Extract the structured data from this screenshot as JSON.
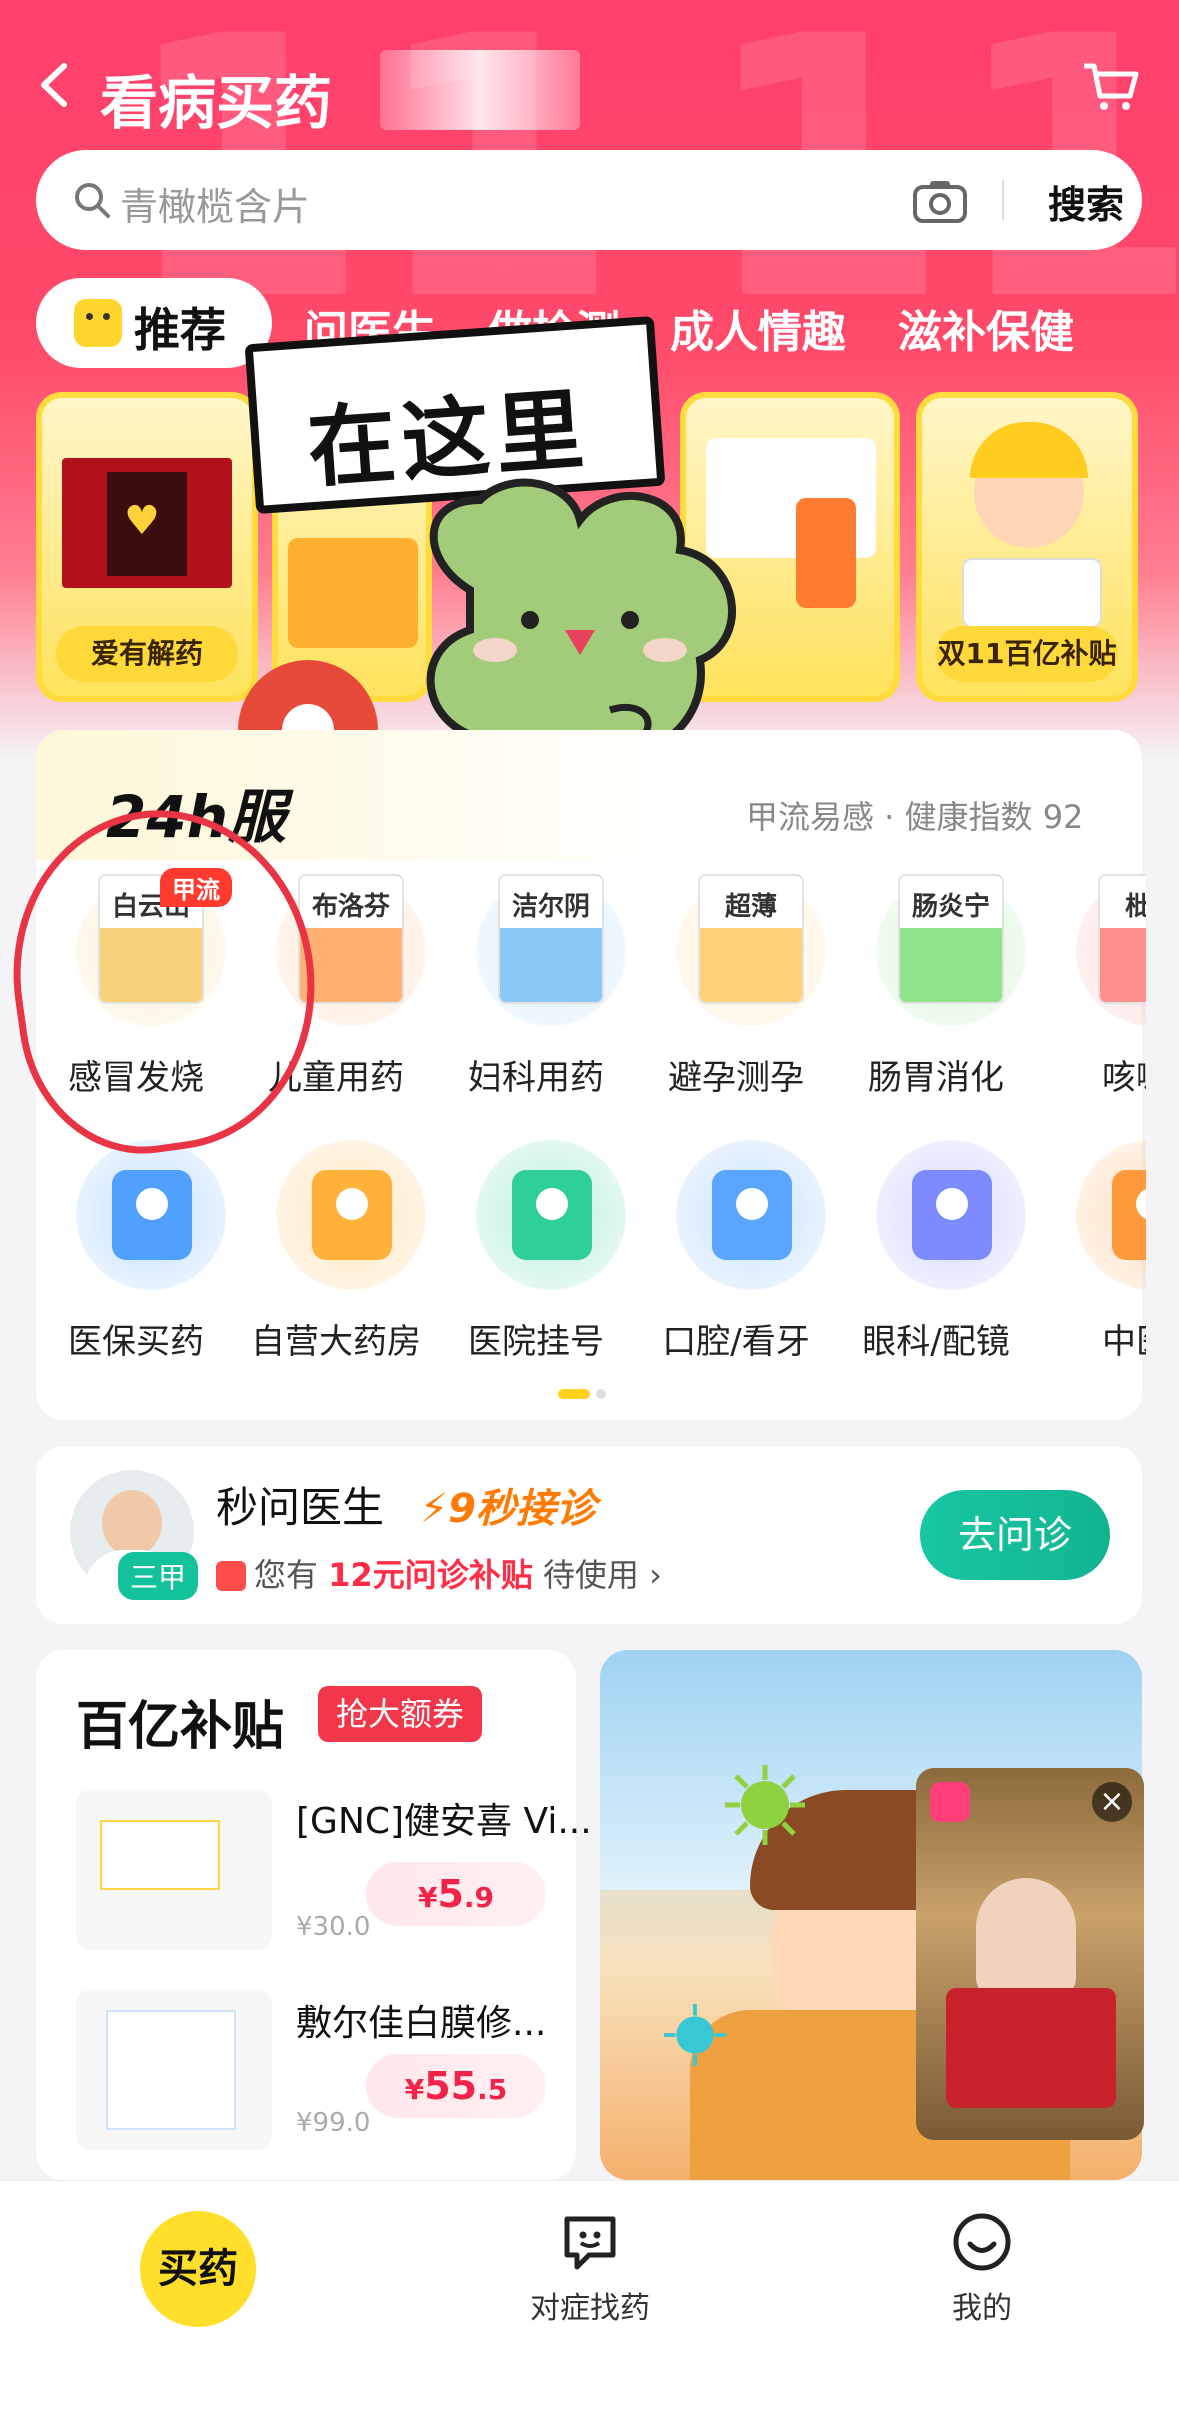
{
  "topbar": {
    "title": "看病买药"
  },
  "search": {
    "placeholder": "青橄榄含片",
    "button": "搜索"
  },
  "categories": {
    "active": "推荐",
    "items": [
      "问医生",
      "做检测",
      "成人情趣",
      "滋补保健"
    ]
  },
  "promos": [
    {
      "label": "爱有解药"
    },
    {
      "label": ""
    },
    {
      "label": ""
    },
    {
      "label": "双11百亿补贴"
    }
  ],
  "sticker": {
    "text": "在这里"
  },
  "service": {
    "title": "24h服",
    "flu_index": "甲流易感 · 健康指数 92"
  },
  "grid_row1": [
    {
      "label": "感冒发烧",
      "pkg": "白云山",
      "tag": "甲流",
      "color": "#f8d27a"
    },
    {
      "label": "儿童用药",
      "pkg": "布洛芬",
      "color": "#ffb174"
    },
    {
      "label": "妇科用药",
      "pkg": "洁尔阴",
      "color": "#8bc9f7"
    },
    {
      "label": "避孕测孕",
      "pkg": "超薄",
      "color": "#ffd27a"
    },
    {
      "label": "肠胃消化",
      "pkg": "肠炎宁",
      "color": "#8fe38a"
    },
    {
      "label": "咳嗽",
      "pkg": "枇杷",
      "color": "#ff8f8f"
    }
  ],
  "grid_row2": [
    {
      "label": "医保买药",
      "icon": "medical-insurance-icon",
      "color": "#4fa0ff"
    },
    {
      "label": "自营大药房",
      "icon": "pharmacy-icon",
      "color": "#ffb13a"
    },
    {
      "label": "医院挂号",
      "icon": "hospital-icon",
      "color": "#2fcf9a"
    },
    {
      "label": "口腔/看牙",
      "icon": "tooth-icon",
      "color": "#58a6ff"
    },
    {
      "label": "眼科/配镜",
      "icon": "eye-chart-icon",
      "color": "#7c8cff"
    },
    {
      "label": "中医",
      "icon": "herb-icon",
      "color": "#ff9a3c"
    }
  ],
  "doctor": {
    "title": "秒问医生",
    "fast": "⚡9秒接诊",
    "sub_prefix": "您有",
    "sub_money": "12元问诊补贴",
    "sub_suffix": "待使用 ›",
    "badge": "三甲",
    "button": "去问诊"
  },
  "subsidy": {
    "title": "百亿补贴",
    "badge": "抢大额券",
    "products": [
      {
        "name": "[GNC]健安喜 Vi...",
        "price_symbol": "¥",
        "price_main": "5",
        "price_dec": ".9",
        "old": "¥30.0"
      },
      {
        "name": "敷尔佳白膜修...",
        "price_symbol": "¥",
        "price_main": "55",
        "price_dec": ".5",
        "old": "¥99.0"
      }
    ]
  },
  "tabbar": {
    "main": "买药",
    "tab2": "对症找药",
    "tab3": "我的"
  },
  "colors": {
    "brand": "#ff3f6c",
    "accent": "#ffdf2b",
    "teal": "#13c29a"
  }
}
